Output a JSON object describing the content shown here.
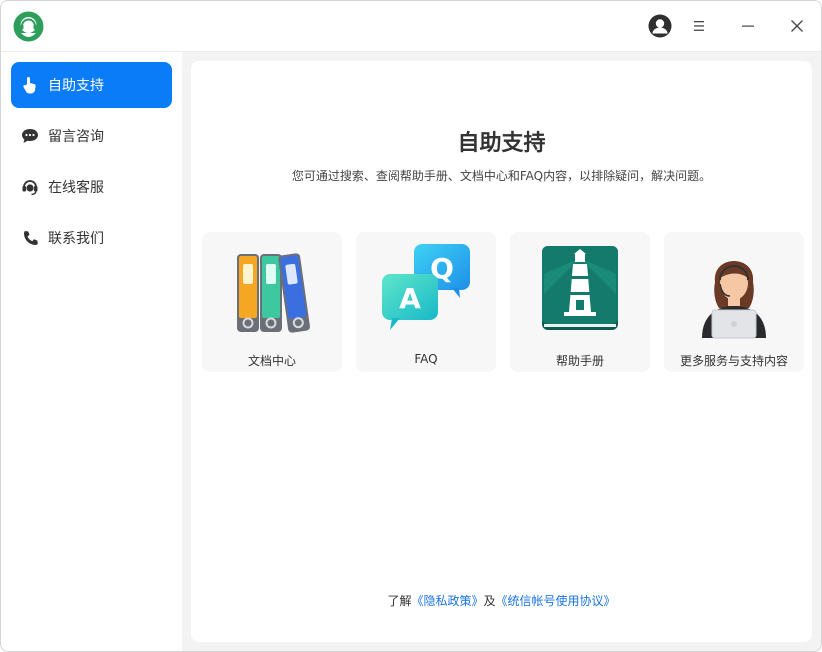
{
  "app": {
    "logo": "customer-support-logo",
    "accent_color": "#0a7cf7"
  },
  "titlebar": {
    "avatar_icon": "user-avatar-icon",
    "menu_icon": "hamburger-menu-icon",
    "minimize_icon": "minimize-icon",
    "close_icon": "close-icon"
  },
  "sidebar": {
    "items": [
      {
        "label": "自助支持",
        "icon": "hand-pointer-icon",
        "active": true
      },
      {
        "label": "留言咨询",
        "icon": "message-bubble-icon",
        "active": false
      },
      {
        "label": "在线客服",
        "icon": "headset-icon",
        "active": false
      },
      {
        "label": "联系我们",
        "icon": "phone-icon",
        "active": false
      }
    ]
  },
  "main": {
    "title": "自助支持",
    "subtitle": "您可通过搜索、查阅帮助手册、文档中心和FAQ内容，以排除疑问，解决问题。",
    "cards": [
      {
        "label": "文档中心",
        "icon": "binders-icon"
      },
      {
        "label": "FAQ",
        "icon": "qa-bubbles-icon"
      },
      {
        "label": "帮助手册",
        "icon": "lighthouse-book-icon"
      },
      {
        "label": "更多服务与支持内容",
        "icon": "support-agent-icon"
      }
    ],
    "footer": {
      "prefix": "了解",
      "privacy_link": "《隐私政策》",
      "joiner": "及",
      "account_link": "《统信帐号使用协议》"
    }
  }
}
